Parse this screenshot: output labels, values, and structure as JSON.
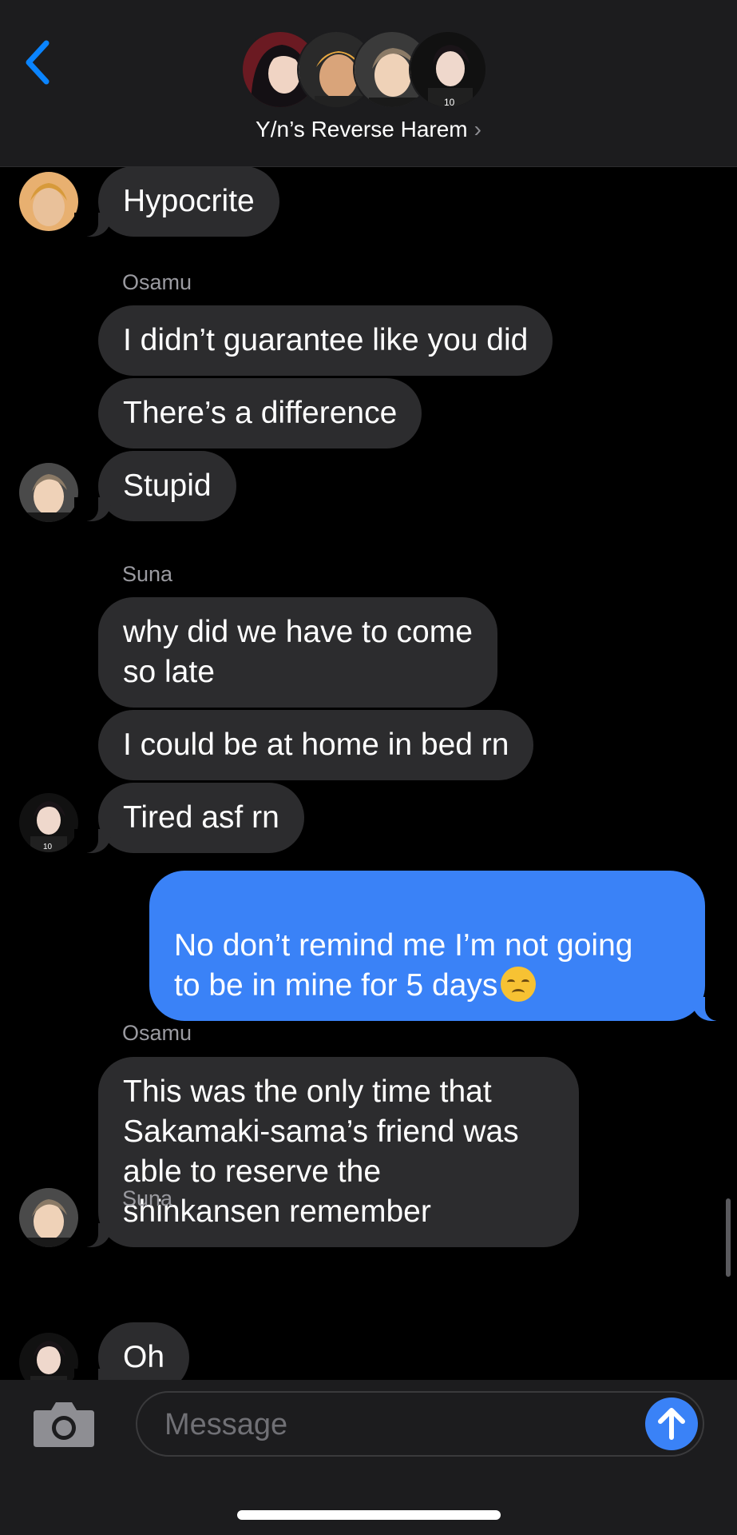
{
  "header": {
    "group_name": "Y/n’s Reverse Harem",
    "chevron": "›"
  },
  "messages": [
    {
      "type": "bubble",
      "text": "Hypocrite",
      "avatar": "atsumu"
    },
    {
      "type": "sender",
      "text": "Osamu"
    },
    {
      "type": "bubble",
      "text": "I didn’t guarantee like you did"
    },
    {
      "type": "bubble",
      "text": "There’s a difference"
    },
    {
      "type": "bubble",
      "text": "Stupid",
      "avatar": "osamu"
    },
    {
      "type": "sender",
      "text": "Suna"
    },
    {
      "type": "bubble",
      "text": "why did we have to come\nso late"
    },
    {
      "type": "bubble",
      "text": "I could be at home in bed rn"
    },
    {
      "type": "bubble",
      "text": "Tired asf rn",
      "avatar": "suna"
    },
    {
      "type": "bubble",
      "text": "No don’t remind me I’m not going\nto be in mine for 5 days",
      "from_me": true,
      "emoji": "disappointed-face"
    },
    {
      "type": "sender",
      "text": "Osamu"
    },
    {
      "type": "bubble",
      "text": "This was the only time that\nSakamaki-sama’s friend was\nable to reserve the\nshinkansen remember",
      "avatar": "osamu"
    },
    {
      "type": "sender",
      "text": "Suna"
    },
    {
      "type": "bubble",
      "text": "Oh",
      "avatar": "suna"
    }
  ],
  "input": {
    "placeholder": "Message"
  },
  "colors": {
    "header_bg": "#1c1c1e",
    "bubble_incoming": "#2c2c2e",
    "bubble_outgoing": "#3a82f7",
    "accent": "#0a84ff"
  }
}
